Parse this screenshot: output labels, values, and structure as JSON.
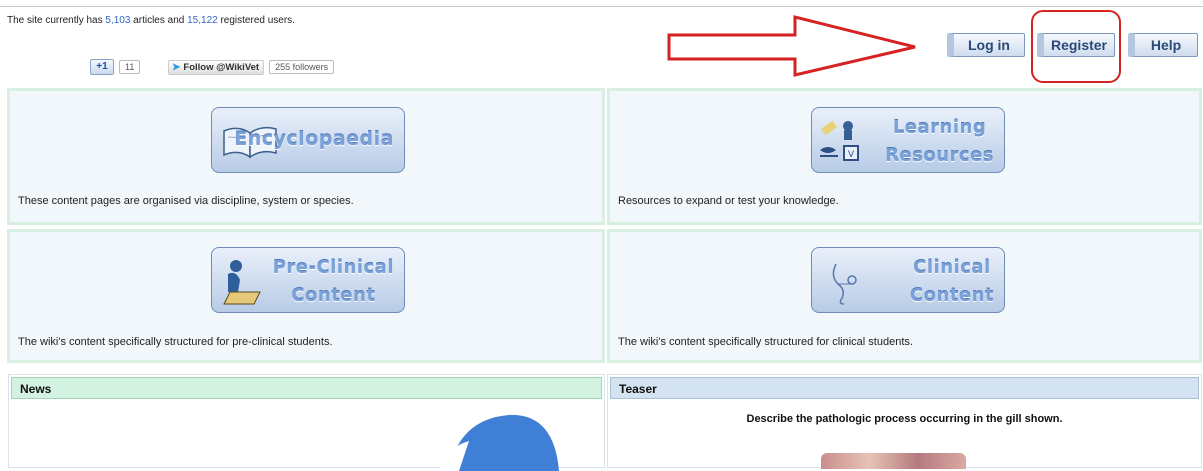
{
  "stats": {
    "prefix": "The site currently has ",
    "articles": "5,103",
    "middle": " articles and ",
    "users": "15,122",
    "suffix": " registered users."
  },
  "social": {
    "gplus_label": "+1",
    "gplus_count": "11",
    "twitter_label": "Follow @WikiVet",
    "followers": "255 followers"
  },
  "header_buttons": {
    "login": "Log in",
    "register": "Register",
    "help": "Help"
  },
  "sections": [
    {
      "tile_lines": [
        "Encyclopaedia"
      ],
      "icon": "book-icon",
      "description": "These content pages are organised via discipline, system or species."
    },
    {
      "tile_lines": [
        "Learning",
        "Resources"
      ],
      "icon": "learning-resources-icons",
      "description": "Resources to expand or test your knowledge."
    },
    {
      "tile_lines": [
        "Pre-Clinical",
        "Content"
      ],
      "icon": "student-reading-icon",
      "description": "The wiki's content specifically structured for pre-clinical students."
    },
    {
      "tile_lines": [
        "Clinical",
        "Content"
      ],
      "icon": "stethoscope-icon",
      "description": "The wiki's content specifically structured for clinical students."
    }
  ],
  "news": {
    "title": "News"
  },
  "teaser": {
    "title": "Teaser",
    "question": "Describe the pathologic process occurring in the gill shown."
  },
  "colors": {
    "annotation_red": "#d62222",
    "panel_bg": "#f2f7fb",
    "panel_border": "#d8f0e2",
    "tile_text": "#7ba1d9"
  }
}
